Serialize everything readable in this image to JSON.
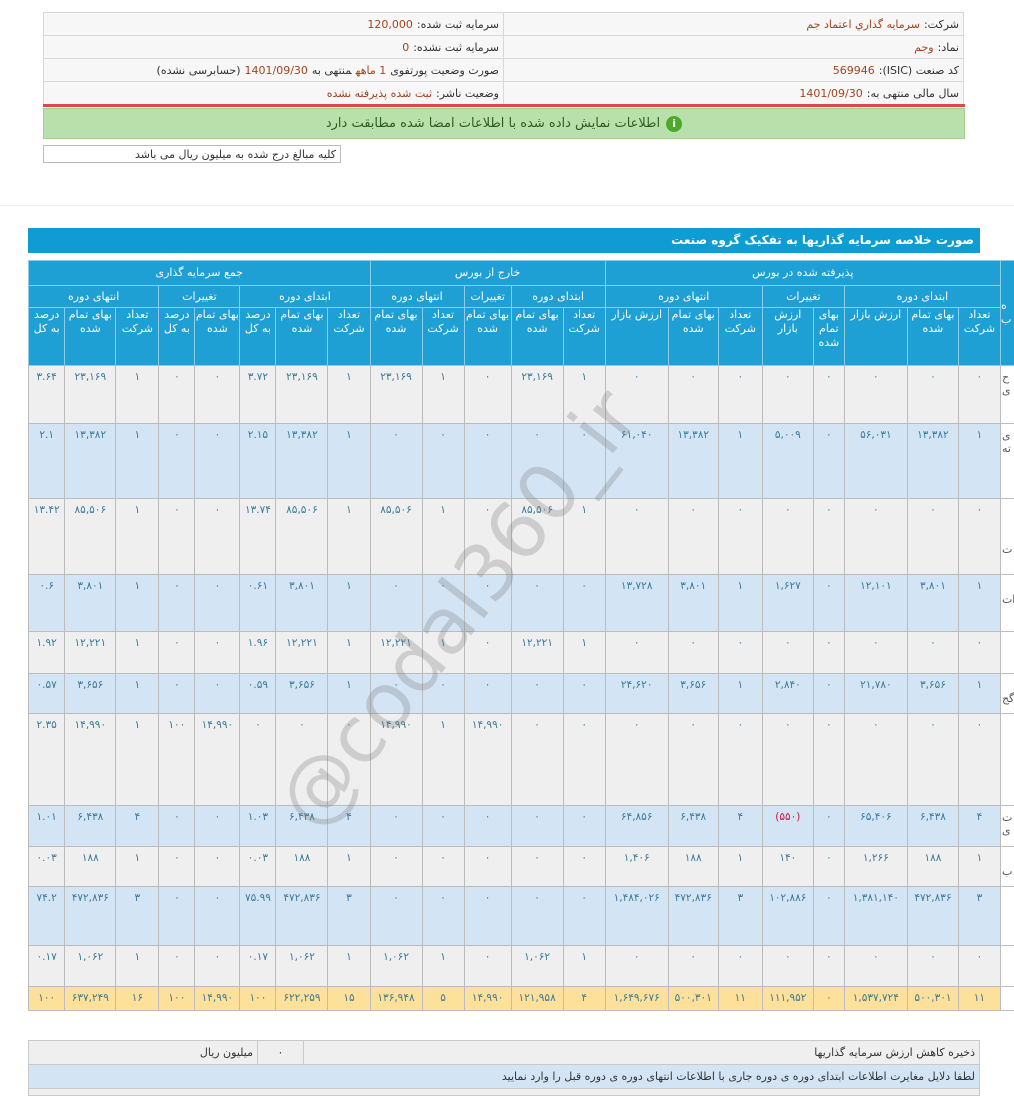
{
  "info": {
    "company_label": "شرکت:",
    "company": "سرمایه گذاري اعتماد جم",
    "registered_capital_label": "سرمایه ثبت شده:",
    "registered_capital": "120,000",
    "symbol_label": "نماد:",
    "symbol": "وجم",
    "unregistered_capital_label": "سرمایه ثبت نشده:",
    "unregistered_capital": "0",
    "isic_label": "کد صنعت (ISIC):",
    "isic": "569946",
    "report_label": "صورت وضعیت پورتفوی",
    "report_period": "1 ماهه",
    "report_ending_label": "منتهی به",
    "report_date": "1401/09/30",
    "report_audit": "(حسابرسی نشده)",
    "fiscal_year_label": "سال مالی منتهی به:",
    "fiscal_year": "1401/09/30",
    "publisher_status_label": "وضعیت ناشر:",
    "publisher_status": "ثبت شده پذیرفته نشده"
  },
  "banner": {
    "icon": "info-icon",
    "text": "اطلاعات نمایش داده شده با اطلاعات امضا شده مطابقت دارد"
  },
  "note": "کلیه مبالغ درج شده به میلیون ریال می باشد",
  "section_title": "صورت خلاصه سرمایه گذاریها به تفکیک گروه صنعت",
  "watermark": "@codal360_ir",
  "colors": {
    "header": "#1fa0d5",
    "row_odd": "#efefef",
    "row_even": "#d3e5f5",
    "total_row": "#fde09a",
    "negative": "#d0143c"
  },
  "table": {
    "name_header": "ه\nب",
    "groups": [
      "پذیرفته شده در بورس",
      "خارج از بورس",
      "جمع سرمایه گذاری"
    ],
    "subgroups": [
      "ابتدای دوره",
      "تغییرات",
      "انتهای دوره",
      "ابتدای دوره",
      "تغییرات",
      "انتهای دوره",
      "ابتدای دوره",
      "تغییرات",
      "انتهای دوره"
    ],
    "columns": [
      "تعداد شرکت",
      "بهای تمام شده",
      "ارزش بازار",
      "بهای تمام شده",
      "ارزش بازار",
      "تعداد شرکت",
      "بهای تمام شده",
      "ارزش بازار",
      "تعداد شرکت",
      "بهای تمام شده",
      "بهای تمام شده",
      "تعداد شرکت",
      "بهای تمام شده",
      "تعداد شرکت",
      "بهای تمام شده",
      "درصد به کل",
      "بهای تمام شده",
      "درصد به کل",
      "تعداد شرکت",
      "بهای تمام شده",
      "درصد به کل"
    ],
    "rows": [
      {
        "name": "ح\nی",
        "cells": [
          "۰",
          "۰",
          "۰",
          "۰",
          "۰",
          "۰",
          "۰",
          "۰",
          "۱",
          "۲۳,۱۶۹",
          "۰",
          "۱",
          "۲۳,۱۶۹",
          "۱",
          "۲۳,۱۶۹",
          "۳.۷۲",
          "۰",
          "۰",
          "۱",
          "۲۳,۱۶۹",
          "۳.۶۴"
        ]
      },
      {
        "name": "ی\nته",
        "cells": [
          "۱",
          "۱۳,۳۸۲",
          "۵۶,۰۳۱",
          "۰",
          "۵,۰۰۹",
          "۱",
          "۱۳,۳۸۲",
          "۶۱,۰۴۰",
          "۰",
          "۰",
          "۰",
          "۰",
          "۰",
          "۱",
          "۱۳,۳۸۲",
          "۲.۱۵",
          "۰",
          "۰",
          "۱",
          "۱۳,۳۸۲",
          "۲.۱"
        ]
      },
      {
        "name": "\n\n\nت",
        "cells": [
          "۰",
          "۰",
          "۰",
          "۰",
          "۰",
          "۰",
          "۰",
          "۰",
          "۱",
          "۸۵,۵۰۶",
          "۰",
          "۱",
          "۸۵,۵۰۶",
          "۱",
          "۸۵,۵۰۶",
          "۱۳.۷۴",
          "۰",
          "۰",
          "۱",
          "۸۵,۵۰۶",
          "۱۳.۴۲"
        ]
      },
      {
        "name": "\nات",
        "cells": [
          "۱",
          "۳,۸۰۱",
          "۱۲,۱۰۱",
          "۰",
          "۱,۶۲۷",
          "۱",
          "۳,۸۰۱",
          "۱۳,۷۲۸",
          "۰",
          "۰",
          "۰",
          "۰",
          "۰",
          "۱",
          "۳,۸۰۱",
          "۰.۶۱",
          "۰",
          "۰",
          "۱",
          "۳,۸۰۱",
          "۰.۶"
        ]
      },
      {
        "name": "",
        "cells": [
          "۰",
          "۰",
          "۰",
          "۰",
          "۰",
          "۰",
          "۰",
          "۰",
          "۱",
          "۱۲,۲۲۱",
          "۰",
          "۱",
          "۱۲,۲۲۱",
          "۱",
          "۱۲,۲۲۱",
          "۱.۹۶",
          "۰",
          "۰",
          "۱",
          "۱۲,۲۲۱",
          "۱.۹۲"
        ]
      },
      {
        "name": "\nگج",
        "cells": [
          "۱",
          "۳,۶۵۶",
          "۲۱,۷۸۰",
          "۰",
          "۲,۸۴۰",
          "۱",
          "۳,۶۵۶",
          "۲۴,۶۲۰",
          "۰",
          "۰",
          "۰",
          "۰",
          "۰",
          "۱",
          "۳,۶۵۶",
          "۰.۵۹",
          "۰",
          "۰",
          "۱",
          "۳,۶۵۶",
          "۰.۵۷"
        ]
      },
      {
        "name": "",
        "cells": [
          "۰",
          "۰",
          "۰",
          "۰",
          "۰",
          "۰",
          "۰",
          "۰",
          "۰",
          "۰",
          "۱۴,۹۹۰",
          "۱",
          "۱۴,۹۹۰",
          "۰",
          "۰",
          "۰",
          "۱۴,۹۹۰",
          "۱۰۰",
          "۱",
          "۱۴,۹۹۰",
          "۲.۳۵"
        ]
      },
      {
        "name": "ت\nی",
        "cells": [
          "۴",
          "۶,۴۳۸",
          "۶۵,۴۰۶",
          "۰",
          "(۵۵۰)",
          "۴",
          "۶,۴۳۸",
          "۶۴,۸۵۶",
          "۰",
          "۰",
          "۰",
          "۰",
          "۰",
          "۴",
          "۶,۴۳۸",
          "۱.۰۳",
          "۰",
          "۰",
          "۴",
          "۶,۴۳۸",
          "۱.۰۱"
        ]
      },
      {
        "name": "\nب",
        "cells": [
          "۱",
          "۱۸۸",
          "۱,۲۶۶",
          "۰",
          "۱۴۰",
          "۱",
          "۱۸۸",
          "۱,۴۰۶",
          "۰",
          "۰",
          "۰",
          "۰",
          "۰",
          "۱",
          "۱۸۸",
          "۰.۰۳",
          "۰",
          "۰",
          "۱",
          "۱۸۸",
          "۰.۰۳"
        ]
      },
      {
        "name": "",
        "cells": [
          "۳",
          "۴۷۲,۸۳۶",
          "۱,۳۸۱,۱۴۰",
          "۰",
          "۱۰۲,۸۸۶",
          "۳",
          "۴۷۲,۸۳۶",
          "۱,۴۸۴,۰۲۶",
          "۰",
          "۰",
          "۰",
          "۰",
          "۰",
          "۳",
          "۴۷۲,۸۳۶",
          "۷۵.۹۹",
          "۰",
          "۰",
          "۳",
          "۴۷۲,۸۳۶",
          "۷۴.۲"
        ]
      },
      {
        "name": "",
        "cells": [
          "۰",
          "۰",
          "۰",
          "۰",
          "۰",
          "۰",
          "۰",
          "۰",
          "۱",
          "۱,۰۶۲",
          "۰",
          "۱",
          "۱,۰۶۲",
          "۱",
          "۱,۰۶۲",
          "۰.۱۷",
          "۰",
          "۰",
          "۱",
          "۱,۰۶۲",
          "۰.۱۷"
        ]
      }
    ],
    "total": {
      "name": "",
      "cells": [
        "۱۱",
        "۵۰۰,۳۰۱",
        "۱,۵۳۷,۷۲۴",
        "۰",
        "۱۱۱,۹۵۲",
        "۱۱",
        "۵۰۰,۳۰۱",
        "۱,۶۴۹,۶۷۶",
        "۴",
        "۱۲۱,۹۵۸",
        "۱۴,۹۹۰",
        "۵",
        "۱۳۶,۹۴۸",
        "۱۵",
        "۶۲۲,۲۵۹",
        "۱۰۰",
        "۱۴,۹۹۰",
        "۱۰۰",
        "۱۶",
        "۶۳۷,۲۴۹",
        "۱۰۰"
      ]
    }
  },
  "bottom": {
    "reserve_label": "ذخیره کاهش ارزش سرمایه گذاریها",
    "reserve_value": "۰",
    "reserve_unit": "میلیون ریال",
    "discrepancy_prompt": "لطفا دلایل مغایرت اطلاعات ابتدای دوره ی دوره جاری با اطلاعات انتهای دوره ی دوره قبل را وارد نمایید"
  }
}
